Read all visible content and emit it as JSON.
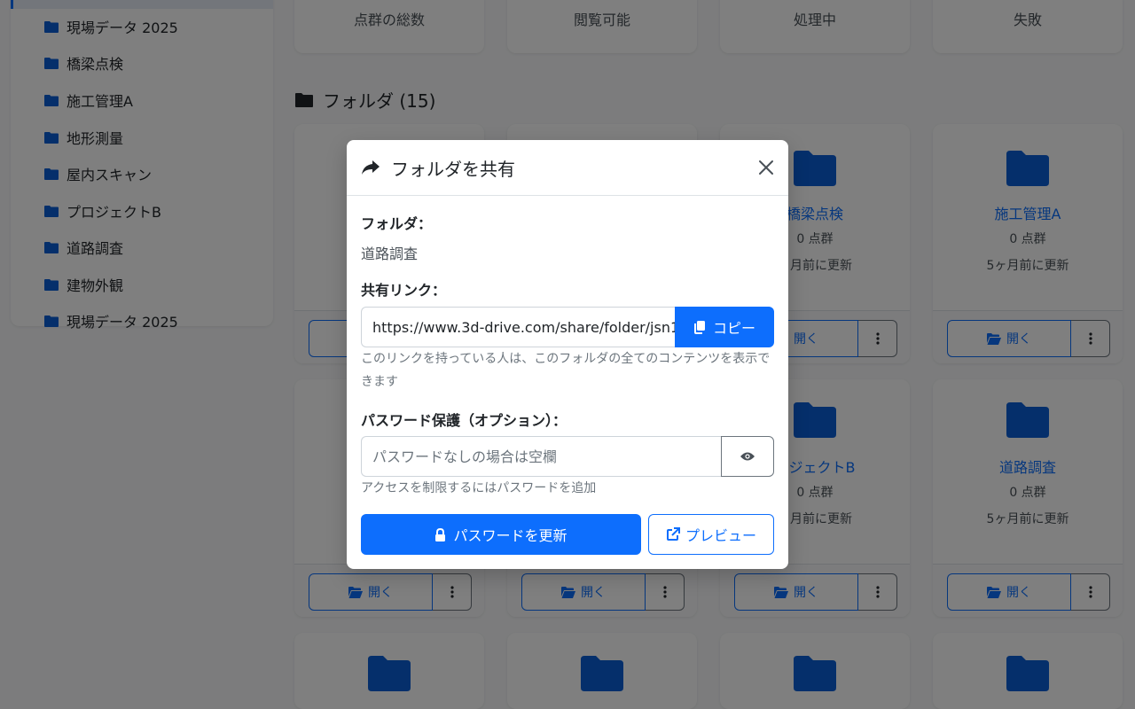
{
  "sidebar": {
    "items": [
      {
        "label": "現場データ 2025"
      },
      {
        "label": "橋梁点検"
      },
      {
        "label": "施工管理A"
      },
      {
        "label": "地形測量"
      },
      {
        "label": "屋内スキャン"
      },
      {
        "label": "プロジェクトB"
      },
      {
        "label": "道路調査"
      },
      {
        "label": "建物外観"
      },
      {
        "label": "現場データ 2025"
      }
    ]
  },
  "stats": [
    {
      "label": "点群の総数"
    },
    {
      "label": "閲覧可能"
    },
    {
      "label": "処理中"
    },
    {
      "label": "失敗"
    }
  ],
  "folders_section": {
    "title": "フォルダ (15)"
  },
  "cards": {
    "row1": [
      {
        "name": "橋梁点検",
        "count": "0 点群",
        "updated": "ヶ月前に更新"
      },
      {
        "name": "施工管理A",
        "count": "0 点群",
        "updated": "5ヶ月前に更新"
      }
    ],
    "row2": [
      {
        "name": "ロジェクトB",
        "count": "0 点群",
        "updated": "ヶ月前に更新"
      },
      {
        "name": "道路調査",
        "count": "0 点群",
        "updated": "5ヶ月前に更新"
      }
    ],
    "open_label": "開く"
  },
  "modal": {
    "title": "フォルダを共有",
    "folder_label": "フォルダ：",
    "folder_name": "道路調査",
    "link_label": "共有リンク：",
    "link_value": "https://www.3d-drive.com/share/folder/jsn1",
    "copy_label": "コピー",
    "link_help": "このリンクを持っている人は、このフォルダの全てのコンテンツを表示できます",
    "password_label": "パスワード保護（オプション）：",
    "password_placeholder": "パスワードなしの場合は空欄",
    "password_help": "アクセスを制限するにはパスワードを追加",
    "update_label": "パスワードを更新",
    "preview_label": "プレビュー"
  },
  "colors": {
    "primary": "#0d6efd",
    "folder_icon": "#0b5ed7"
  }
}
